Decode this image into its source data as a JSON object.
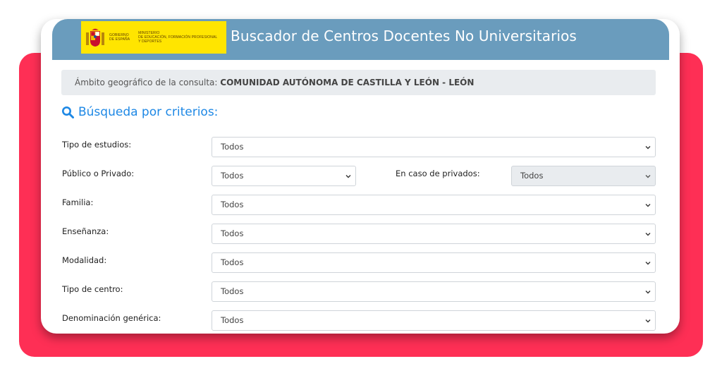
{
  "header": {
    "logo_gov_line1": "Gobierno",
    "logo_gov_line2": "de España",
    "logo_min_line1": "Ministerio",
    "logo_min_line2": "de Educación, Formación Profesional",
    "logo_min_line3": "y Deportes",
    "title": "Buscador de Centros Docentes No Universitarios"
  },
  "scope": {
    "label": "Ámbito geográfico de la consulta:",
    "value": "COMUNIDAD AUTÓNOMA DE CASTILLA Y LEÓN - LEÓN"
  },
  "section": {
    "title": "Búsqueda por criterios:"
  },
  "fields": {
    "tipo_estudios": {
      "label": "Tipo de estudios:",
      "value": "Todos"
    },
    "publico_privado": {
      "label": "Público o Privado:",
      "value": "Todos"
    },
    "caso_privados": {
      "label": "En caso de privados:",
      "value": "Todos"
    },
    "familia": {
      "label": "Familia:",
      "value": "Todos"
    },
    "ensenanza": {
      "label": "Enseñanza:",
      "value": "Todos"
    },
    "modalidad": {
      "label": "Modalidad:",
      "value": "Todos"
    },
    "tipo_centro": {
      "label": "Tipo de centro:",
      "value": "Todos"
    },
    "denominacion": {
      "label": "Denominación genérica:",
      "value": "Todos"
    }
  },
  "colors": {
    "header_bg": "#6a9cbd",
    "accent": "#1e88e5",
    "backdrop": "#fe2f55",
    "logo_bg": "#ffe500"
  }
}
